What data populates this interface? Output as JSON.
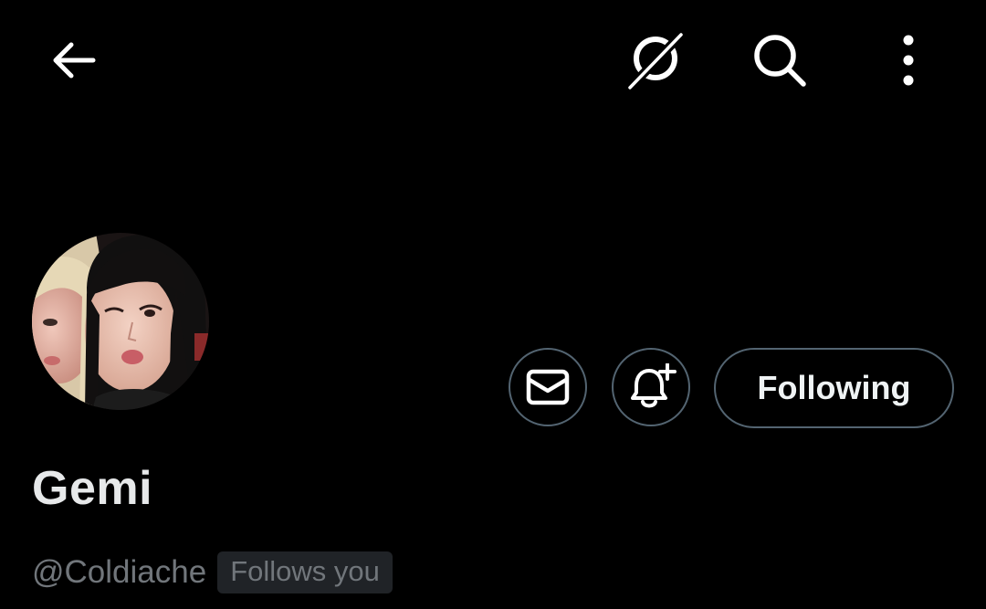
{
  "header": {
    "back_icon": "arrow-left-icon",
    "grok_icon": "grok-icon",
    "search_icon": "search-icon",
    "more_icon": "more-vertical-icon"
  },
  "profile": {
    "name": "Gemi",
    "handle": "@Coldiache",
    "follows_you": "Follows you",
    "avatar_icon": "avatar"
  },
  "actions": {
    "message_icon": "envelope-icon",
    "notify_icon": "bell-plus-icon",
    "following_label": "Following"
  },
  "colors": {
    "background": "#000000",
    "text_primary": "#e7e9ea",
    "text_secondary": "#71767b",
    "border": "#536471",
    "badge_bg": "#202327"
  }
}
